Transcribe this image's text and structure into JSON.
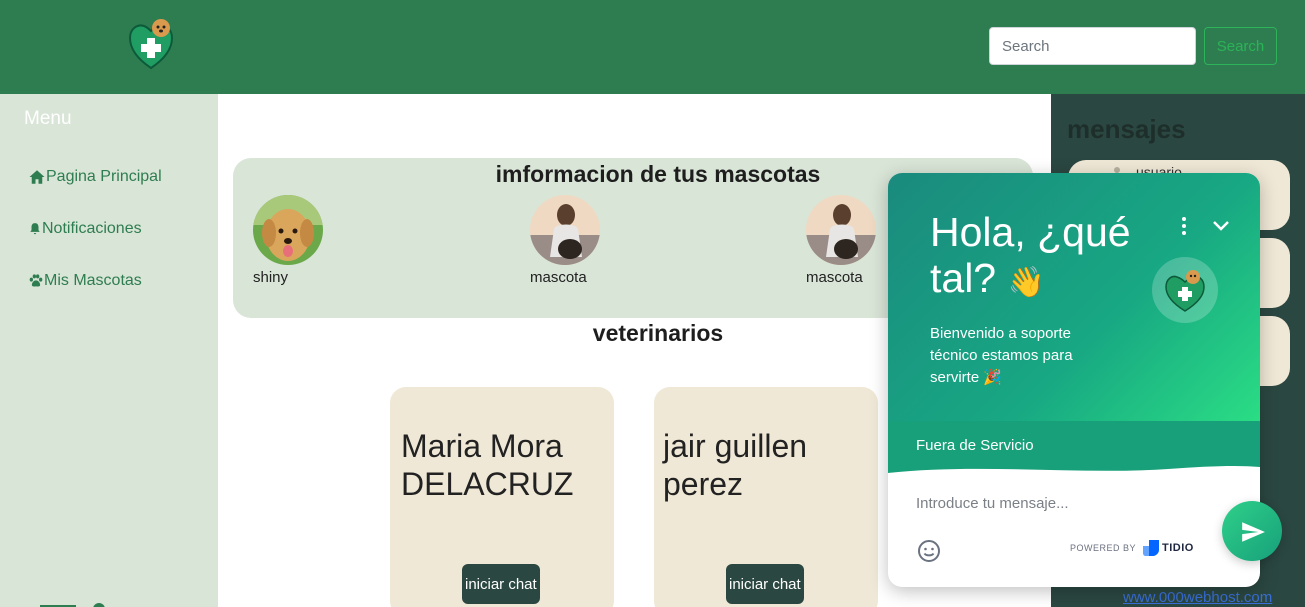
{
  "header": {
    "search_placeholder": "Search",
    "search_button": "Search"
  },
  "sidebar": {
    "title": "Menu",
    "items": [
      {
        "label": "Pagina Principal",
        "icon": "home-icon"
      },
      {
        "label": "Notificaciones",
        "icon": "bell-icon"
      },
      {
        "label": "Mis Mascotas",
        "icon": "paw-icon"
      }
    ]
  },
  "pets": {
    "title": "imformacion de tus mascotas",
    "items": [
      {
        "name": "shiny"
      },
      {
        "name": "mascota"
      },
      {
        "name": "mascota"
      }
    ]
  },
  "vets": {
    "title": "veterinarios",
    "items": [
      {
        "name": "Maria Mora DELACRUZ",
        "button": "iniciar chat"
      },
      {
        "name": "jair guillen perez",
        "button": "iniciar chat"
      }
    ]
  },
  "messages": {
    "title": "mensajes",
    "items": [
      {
        "user": "usuario"
      }
    ]
  },
  "chat_widget": {
    "greeting": "Hola, ¿qué tal?",
    "greeting_emoji": "👋",
    "subtitle": "Bienvenido a soporte técnico estamos para servirte",
    "subtitle_emoji": "🎉",
    "status": "Fuera de Servicio",
    "input_placeholder": "Introduce tu mensaje...",
    "powered_by": "POWERED BY",
    "brand": "TIDIO"
  },
  "footer": {
    "link": "www.000webhost.com"
  },
  "colors": {
    "header": "#2e7d50",
    "sidebar": "#d9e5d7",
    "card": "#f0e8d6",
    "dark": "#2b4741",
    "accent": "#2bb357"
  }
}
